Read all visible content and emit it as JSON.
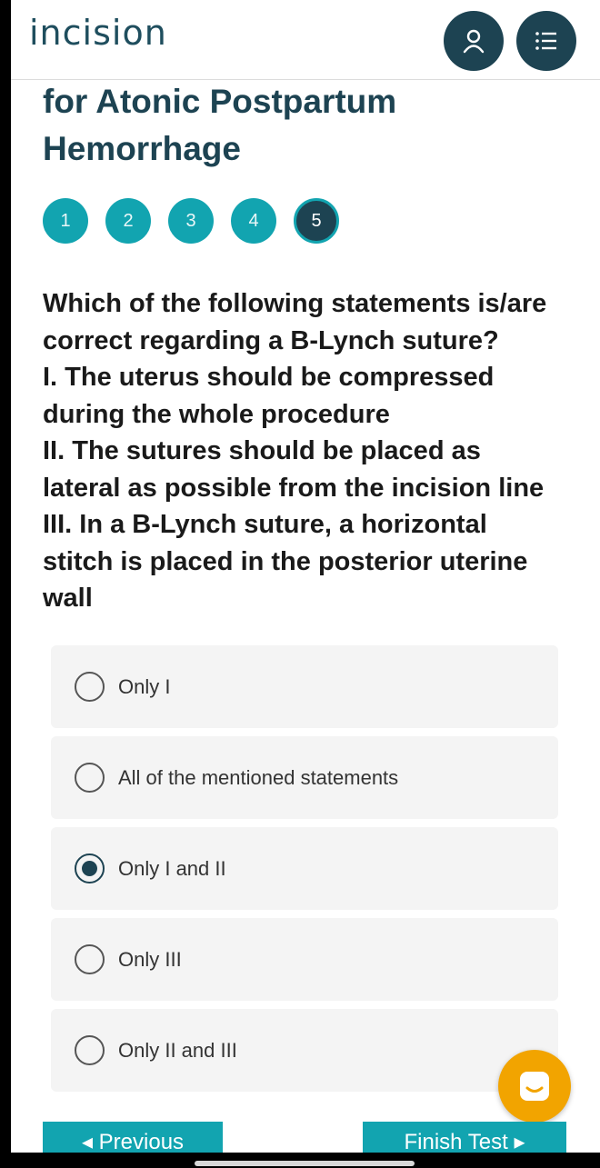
{
  "header": {
    "logo": "incision",
    "user_icon": "user-icon",
    "menu_icon": "list-menu-icon"
  },
  "page": {
    "title_line1": "for Atonic Postpartum",
    "title_line2": "Hemorrhage"
  },
  "steps": [
    "1",
    "2",
    "3",
    "4",
    "5"
  ],
  "active_step": "5",
  "question": {
    "lines": [
      "Which of the following statements is/are",
      "correct regarding a B-Lynch suture?",
      "I. The uterus should be compressed",
      "during the whole procedure",
      "II. The sutures should be placed as",
      "lateral as possible from the incision line",
      "III. In a B-Lynch suture, a horizontal",
      "stitch is placed in the posterior uterine",
      "wall"
    ]
  },
  "options": [
    {
      "label": "Only I",
      "selected": false
    },
    {
      "label": "All of the mentioned statements",
      "selected": false
    },
    {
      "label": "Only I and II",
      "selected": true
    },
    {
      "label": "Only III",
      "selected": false
    },
    {
      "label": "Only II and III",
      "selected": false
    }
  ],
  "nav": {
    "previous": "◂ Previous",
    "finish": "Finish Test ▸"
  },
  "chat_icon": "chat-icon",
  "colors": {
    "brand_dark": "#1d4352",
    "brand_teal": "#12a4b0",
    "chat_orange": "#f2a400"
  }
}
